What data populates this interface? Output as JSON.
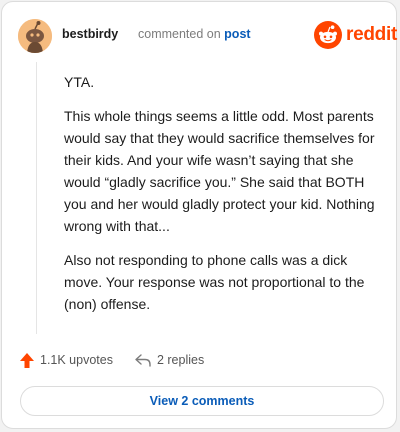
{
  "comment": {
    "username": "bestbirdy",
    "action_text": "commented on",
    "post_link": "post",
    "avatar_icon": "snoo-avatar-icon",
    "paragraphs": [
      "YTA.",
      "This whole things seems a little odd. Most parents would say that they would sacrifice themselves for their kids. And your wife wasn’t saying that she would “gladly sacrifice you.” She said that BOTH you and her would gladly protect your kid. Nothing wrong with that...",
      "Also not responding to phone calls was a dick move. Your response was not proportional to the (non) offense."
    ]
  },
  "brand": {
    "name": "reddit",
    "logo_icon": "reddit-logo-icon",
    "color": "#ff4500"
  },
  "actions": {
    "upvotes_label": "1.1K upvotes",
    "upvote_icon": "upvote-arrow-icon",
    "upvote_color": "#ff4500",
    "replies_label": "2 replies",
    "reply_icon": "reply-arrow-icon"
  },
  "view_comments_label": "View 2 comments",
  "link_color": "#0a5cb8"
}
